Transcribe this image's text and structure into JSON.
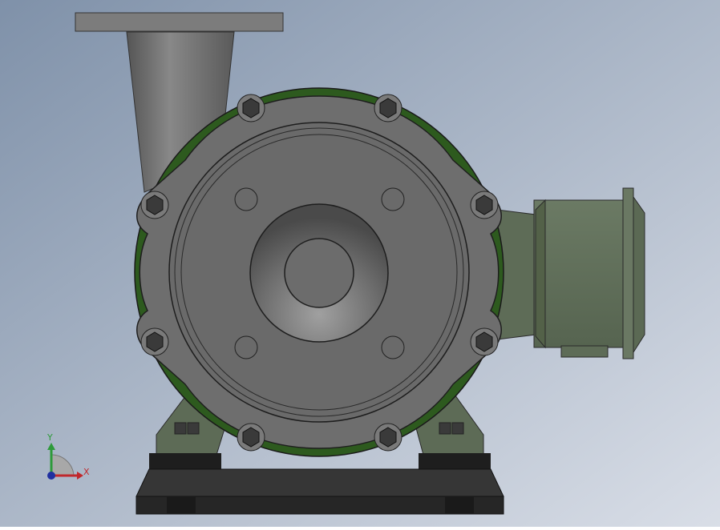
{
  "viewport": {
    "bg_top": "#8a9ab0",
    "bg_bottom": "#d6dbe5"
  },
  "model": {
    "casing_color": "#6c6c6c",
    "gasket_color": "#2d5a1e",
    "motor_color": "#5f6e58",
    "base_color": "#2a2a2a",
    "pipe_color": "#7a7a7a"
  },
  "triad": {
    "x_label": "X",
    "y_label": "Y",
    "x_color": "#c0282c",
    "y_color": "#2e9a3a",
    "z_color": "#1f2fa0"
  }
}
